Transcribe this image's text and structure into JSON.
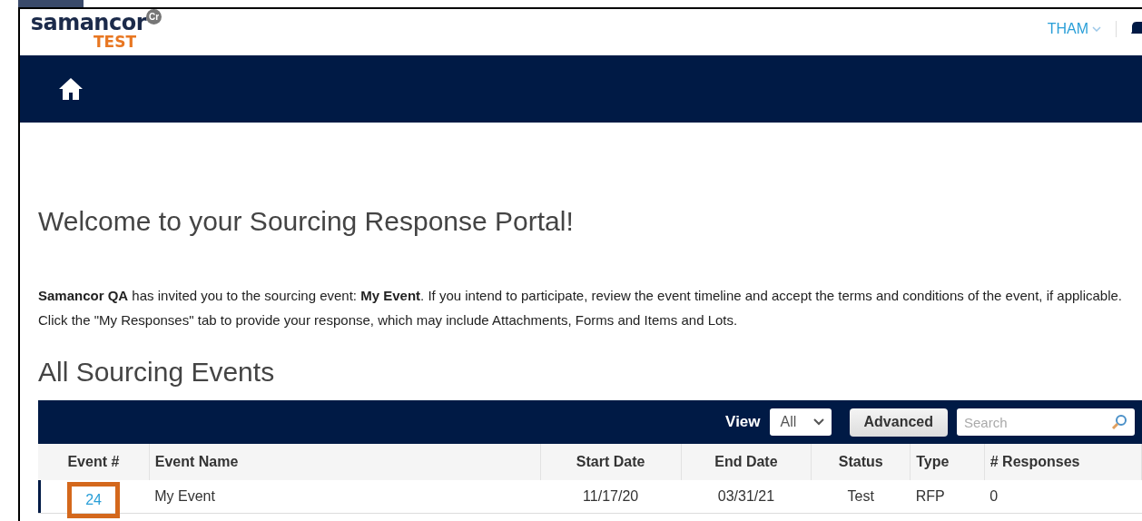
{
  "header": {
    "logo": {
      "name": "samancor",
      "badge": "Cr",
      "env": "TEST"
    },
    "user_menu": "THAM"
  },
  "welcome_title": "Welcome to your Sourcing Response Portal!",
  "invitation_text": "**Samancor QA** has invited you to the sourcing event: **My Event**. If you intend to participate, review the event timeline and accept the terms and conditions of the event, if applicable. Click the \"My Responses\" tab to provide your response, which may include Attachments, Forms and Items and Lots.",
  "events_title": "All Sourcing Events",
  "toolbar": {
    "view_label": "View",
    "view_value": "All",
    "advanced_button": "Advanced",
    "search": {
      "placeholder": "Search"
    }
  },
  "table": {
    "columns": [
      "Event #",
      "Event Name",
      "Start Date",
      "End Date",
      "Status",
      "Type",
      "# Responses"
    ],
    "rows": [
      {
        "selected": true,
        "highlighted": true,
        "cells": [
          "24",
          "My Event",
          "11/17/20",
          "03/31/21",
          "Test",
          "RFP",
          "0"
        ]
      }
    ]
  }
}
